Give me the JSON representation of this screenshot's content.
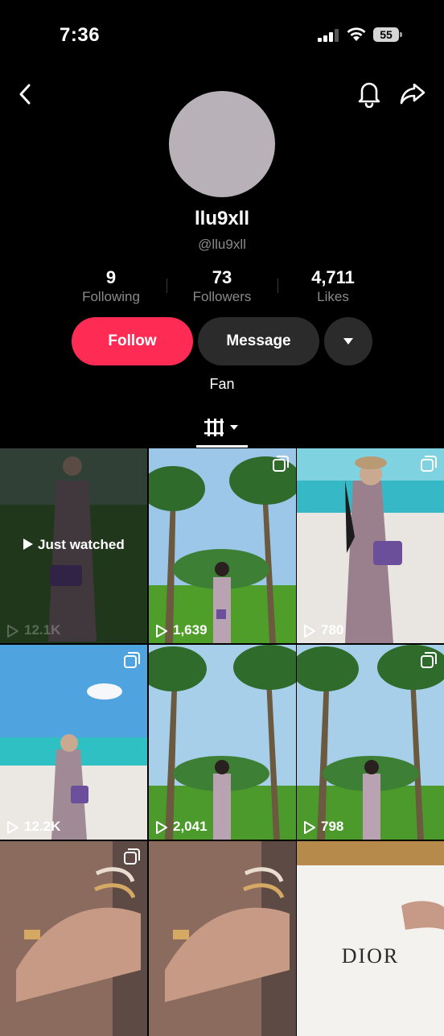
{
  "status": {
    "time": "7:36",
    "battery": "55"
  },
  "profile": {
    "username": "llu9xll",
    "handle": "@llu9xll",
    "stats": [
      {
        "value": "9",
        "label": "Following"
      },
      {
        "value": "73",
        "label": "Followers"
      },
      {
        "value": "4,711",
        "label": "Likes"
      }
    ],
    "follow_label": "Follow",
    "message_label": "Message",
    "fan_label": "Fan"
  },
  "colors": {
    "accent": "#fe2c55",
    "secondary_button": "#2b2b2b"
  },
  "icons": [
    "back-icon",
    "bell-icon",
    "share-icon",
    "videos-grid-icon",
    "multi-photo-icon",
    "play-icon"
  ],
  "videos": [
    {
      "views": "12.1K",
      "overlay": "Just watched"
    },
    {
      "views": "1,639"
    },
    {
      "views": "780"
    },
    {
      "views": "12.2K"
    },
    {
      "views": "2,041"
    },
    {
      "views": "798"
    },
    {
      "views": ""
    },
    {
      "views": ""
    },
    {
      "views": "",
      "brand_text": "DIOR"
    }
  ]
}
